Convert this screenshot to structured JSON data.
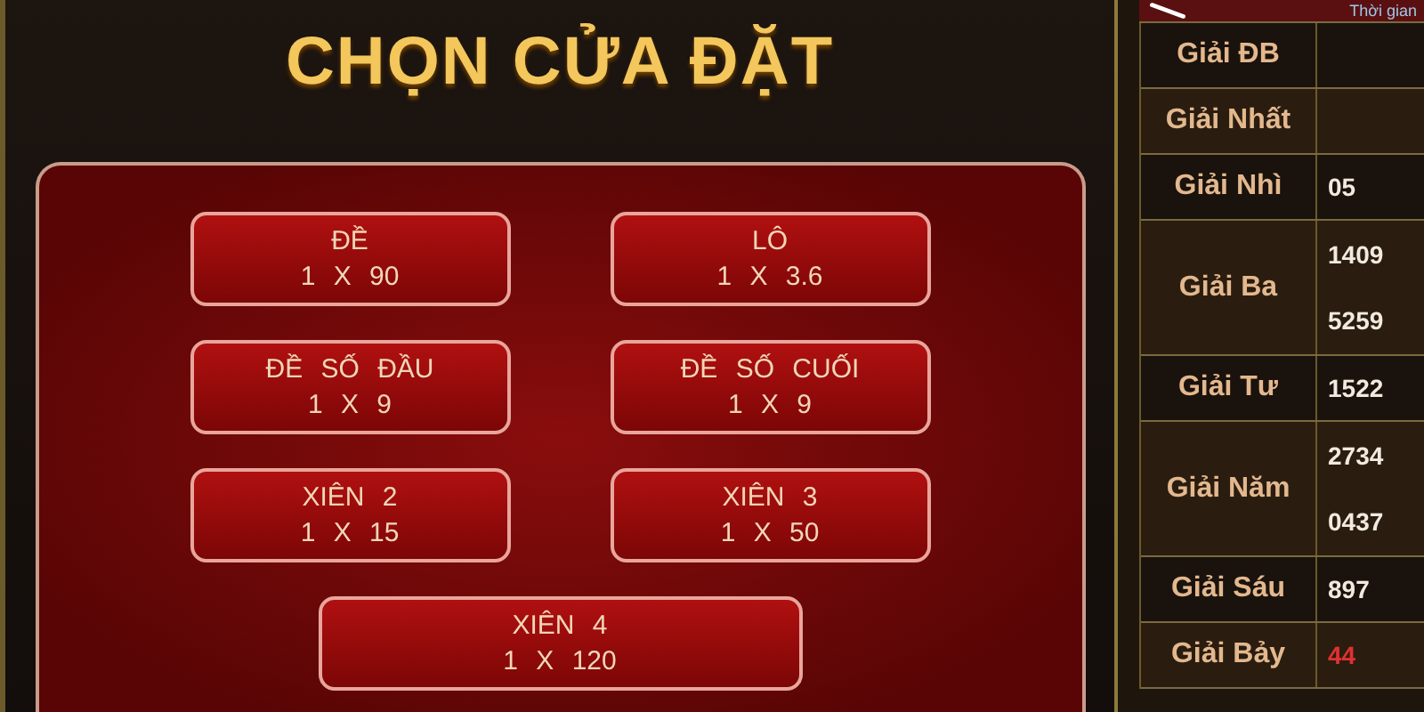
{
  "title": "CHỌN CỬA ĐẶT",
  "bets": [
    {
      "name": "ĐỀ",
      "odds": "1 X 90"
    },
    {
      "name": "LÔ",
      "odds": "1 X 3.6"
    },
    {
      "name": "ĐỀ SỐ ĐẦU",
      "odds": "1 X 9"
    },
    {
      "name": "ĐỀ SỐ CUỐI",
      "odds": "1 X 9"
    },
    {
      "name": "XIÊN 2",
      "odds": "1 X 15"
    },
    {
      "name": "XIÊN 3",
      "odds": "1 X 50"
    },
    {
      "name": "XIÊN 4",
      "odds": "1 X 120"
    }
  ],
  "results": {
    "header": "Thời gian",
    "rows": [
      {
        "prize": "Giải ĐB",
        "values": []
      },
      {
        "prize": "Giải Nhất",
        "values": []
      },
      {
        "prize": "Giải Nhì",
        "values": [
          "05"
        ]
      },
      {
        "prize": "Giải Ba",
        "values": [
          "1409",
          "5259"
        ]
      },
      {
        "prize": "Giải Tư",
        "values": [
          "1522"
        ]
      },
      {
        "prize": "Giải Năm",
        "values": [
          "2734",
          "0437"
        ]
      },
      {
        "prize": "Giải Sáu",
        "values": [
          "897"
        ]
      },
      {
        "prize": "Giải Bảy",
        "values": [
          "44"
        ],
        "highlight": true
      }
    ]
  }
}
